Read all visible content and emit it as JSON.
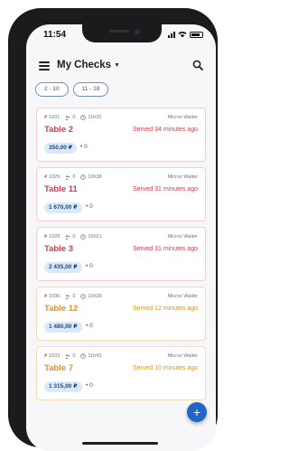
{
  "status": {
    "time": "11:54"
  },
  "header": {
    "title": "My Checks"
  },
  "filters": [
    {
      "label": "2 - 10"
    },
    {
      "label": "11 - 18"
    }
  ],
  "checks": [
    {
      "number": "1031",
      "guests": "0",
      "time": "11h20",
      "waiter": "Micros Waiter",
      "table": "Table 2",
      "served": "Served 34 minutes ago",
      "amount": "350,00 ₽",
      "extra": "0",
      "status": "late"
    },
    {
      "number": "1029",
      "guests": "0",
      "time": "10h38",
      "waiter": "Micros Waiter",
      "table": "Table 11",
      "served": "Served 31 minutes ago",
      "amount": "1 670,00 ₽",
      "extra": "0",
      "status": "late"
    },
    {
      "number": "1028",
      "guests": "0",
      "time": "10h21",
      "waiter": "Micros Waiter",
      "table": "Table 3",
      "served": "Served 31 minutes ago",
      "amount": "2 435,00 ₽",
      "extra": "0",
      "status": "late"
    },
    {
      "number": "1030",
      "guests": "0",
      "time": "10h39",
      "waiter": "Micros Waiter",
      "table": "Table 12",
      "served": "Served 12 minutes ago",
      "amount": "1 480,00 ₽",
      "extra": "0",
      "status": "warn"
    },
    {
      "number": "1033",
      "guests": "0",
      "time": "11h43",
      "waiter": "Micros Waiter",
      "table": "Table 7",
      "served": "Served 10 minutes ago",
      "amount": "1 315,00 ₽",
      "extra": "0",
      "status": "warn"
    }
  ],
  "fab": {
    "label": "+"
  },
  "colors": {
    "late": "#d23b48",
    "warn": "#e09226",
    "accent": "#1f66c8"
  }
}
